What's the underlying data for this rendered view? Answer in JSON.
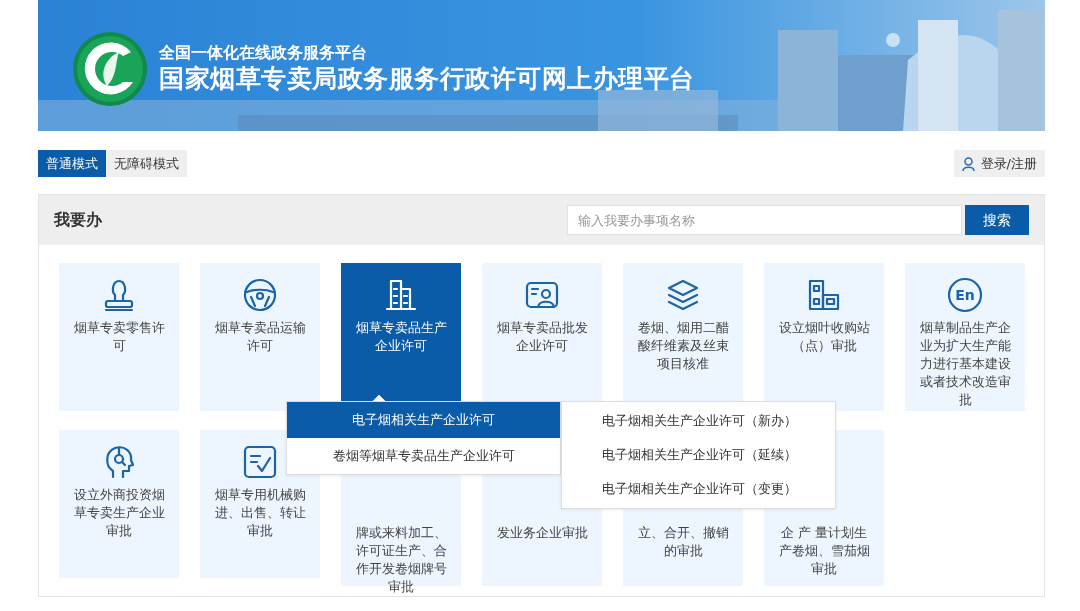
{
  "banner": {
    "subtitle": "全国一体化在线政务服务平台",
    "title": "国家烟草专卖局政务服务行政许可网上办理平台"
  },
  "modes": [
    {
      "label": "普通模式",
      "selected": true
    },
    {
      "label": "无障碍模式",
      "selected": false
    }
  ],
  "login": {
    "label": "登录/注册"
  },
  "panel": {
    "title": "我要办",
    "search": {
      "placeholder": "输入我要办事项名称",
      "button": "搜索"
    }
  },
  "tiles": [
    {
      "kind": "tile",
      "label": "烟草专卖零售许可",
      "selected": false
    },
    {
      "kind": "tile",
      "label": "烟草专卖品运输许可",
      "selected": false
    },
    {
      "kind": "tile",
      "label": "烟草专卖品生产企业许可",
      "selected": true
    },
    {
      "kind": "tile",
      "label": "烟草专卖品批发企业许可",
      "selected": false
    },
    {
      "kind": "tile",
      "label": "卷烟、烟用二醋酸纤维素及丝束项目核准",
      "selected": false
    },
    {
      "kind": "tile",
      "label": "设立烟叶收购站（点）审批",
      "selected": false
    },
    {
      "kind": "tile",
      "label": "烟草制品生产企业为扩大生产能力进行基本建设或者技术改造审批",
      "selected": false,
      "icon_text": "En"
    },
    {
      "kind": "tile",
      "label": "设立外商投资烟草专卖生产企业审批",
      "selected": false
    },
    {
      "kind": "tile",
      "label": "烟草专用机械购进、出售、转让审批",
      "selected": false
    },
    {
      "kind": "covered",
      "label": "牌或来料加工、许可证生产、合作开发卷烟牌号审批",
      "selected": false
    },
    {
      "kind": "covered",
      "label": "发业务企业审批",
      "selected": false
    },
    {
      "kind": "covered",
      "label": "立、合开、撤销的审批",
      "selected": false
    },
    {
      "kind": "covered",
      "label": "企 产 量计划生产卷烟、雪茄烟审批",
      "selected": false
    }
  ],
  "menu": {
    "items": [
      {
        "label": "电子烟相关生产企业许可",
        "selected": true
      },
      {
        "label": "卷烟等烟草专卖品生产企业许可",
        "selected": false
      }
    ],
    "submenu": [
      {
        "label": "电子烟相关生产企业许可（新办）"
      },
      {
        "label": "电子烟相关生产企业许可（延续）"
      },
      {
        "label": "电子烟相关生产企业许可（变更）"
      }
    ]
  }
}
